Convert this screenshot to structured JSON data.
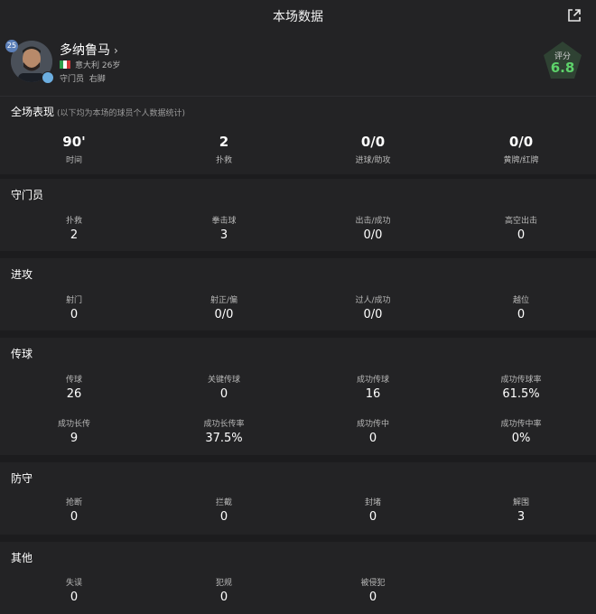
{
  "header": {
    "title": "本场数据",
    "share_icon": "share-icon"
  },
  "player": {
    "number": "25",
    "name": "多纳鲁马",
    "chevron": "›",
    "country": "意大利",
    "age": "26岁",
    "position": "守门员",
    "foot": "右脚",
    "rating_label": "评分",
    "rating_value": "6.8"
  },
  "overall": {
    "title": "全场表现",
    "note": "(以下均为本场的球员个人数据统计)",
    "stats": [
      {
        "value": "90'",
        "label": "时间"
      },
      {
        "value": "2",
        "label": "扑救"
      },
      {
        "value": "0/0",
        "label": "进球/助攻"
      },
      {
        "value": "0/0",
        "label": "黄牌/红牌"
      }
    ]
  },
  "goalkeeping": {
    "title": "守门员",
    "stats": [
      {
        "label": "扑救",
        "value": "2"
      },
      {
        "label": "拳击球",
        "value": "3"
      },
      {
        "label": "出击/成功",
        "value": "0/0"
      },
      {
        "label": "高空出击",
        "value": "0"
      }
    ]
  },
  "attack": {
    "title": "进攻",
    "stats": [
      {
        "label": "射门",
        "value": "0"
      },
      {
        "label": "射正/偏",
        "value": "0/0"
      },
      {
        "label": "过人/成功",
        "value": "0/0"
      },
      {
        "label": "越位",
        "value": "0"
      }
    ]
  },
  "passing": {
    "title": "传球",
    "stats": [
      {
        "label": "传球",
        "value": "26"
      },
      {
        "label": "关键传球",
        "value": "0"
      },
      {
        "label": "成功传球",
        "value": "16"
      },
      {
        "label": "成功传球率",
        "value": "61.5%"
      },
      {
        "label": "成功长传",
        "value": "9"
      },
      {
        "label": "成功长传率",
        "value": "37.5%"
      },
      {
        "label": "成功传中",
        "value": "0"
      },
      {
        "label": "成功传中率",
        "value": "0%"
      }
    ]
  },
  "defense": {
    "title": "防守",
    "stats": [
      {
        "label": "抢断",
        "value": "0"
      },
      {
        "label": "拦截",
        "value": "0"
      },
      {
        "label": "封堵",
        "value": "0"
      },
      {
        "label": "解围",
        "value": "3"
      }
    ]
  },
  "other": {
    "title": "其他",
    "stats": [
      {
        "label": "失误",
        "value": "0"
      },
      {
        "label": "犯规",
        "value": "0"
      },
      {
        "label": "被侵犯",
        "value": "0"
      }
    ]
  }
}
